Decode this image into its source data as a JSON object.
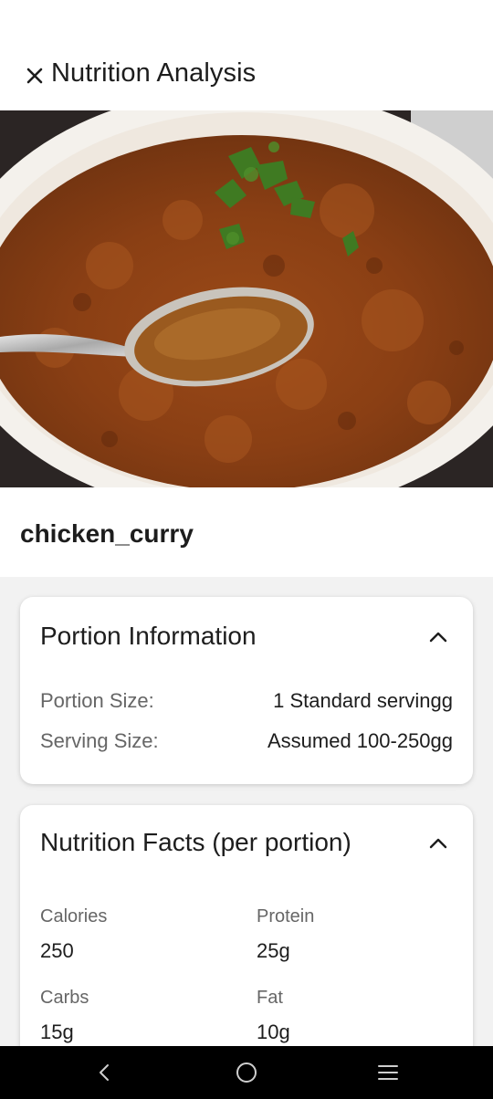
{
  "header": {
    "title": "Nutrition Analysis",
    "close_icon": "close-icon"
  },
  "photo": {
    "subject": "chicken curry in white bowl with spoon and cilantro garnish"
  },
  "food": {
    "name": "chicken_curry"
  },
  "portion_card": {
    "title": "Portion Information",
    "rows": [
      {
        "label": "Portion Size:",
        "value": "1 Standard servingg"
      },
      {
        "label": "Serving Size:",
        "value": "Assumed 100-250gg"
      }
    ]
  },
  "nutrition_card": {
    "title": "Nutrition Facts (per portion)",
    "facts": [
      {
        "label": "Calories",
        "value": "250"
      },
      {
        "label": "Protein",
        "value": "25g"
      },
      {
        "label": "Carbs",
        "value": "15g"
      },
      {
        "label": "Fat",
        "value": "10g"
      }
    ]
  },
  "navbar": {
    "back_icon": "back-icon",
    "home_icon": "home-icon",
    "recents_icon": "recents-icon"
  },
  "colors": {
    "header_bg": "#ffffff",
    "page_bg": "#f2f2f2",
    "card_bg": "#ffffff",
    "text_primary": "#1d1d1d",
    "text_secondary": "#666666",
    "navbar_bg": "#000000"
  }
}
